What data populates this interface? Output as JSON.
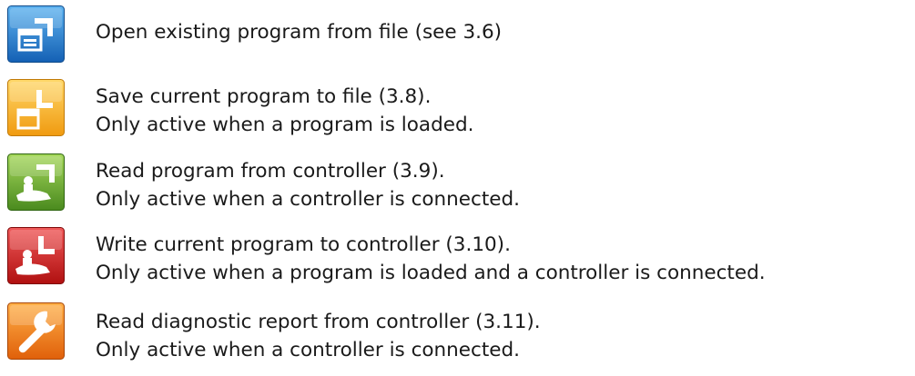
{
  "items": [
    {
      "icon": "open-folder-icon",
      "color": "#1e78c8",
      "line1": "Open existing program from file (see 3.6)",
      "line2": ""
    },
    {
      "icon": "save-disk-icon",
      "color": "#f2a81c",
      "line1": "Save current program to file (3.8).",
      "line2": "Only active when a program is loaded."
    },
    {
      "icon": "read-from-controller-icon",
      "color": "#5c9e2a",
      "line1": "Read program from controller (3.9).",
      "line2": "Only active when a controller is connected."
    },
    {
      "icon": "write-to-controller-icon",
      "color": "#c81e1e",
      "line1": "Write current program to controller (3.10).",
      "line2": "Only active when a program is loaded and a controller is connected."
    },
    {
      "icon": "wrench-icon",
      "color": "#f07a14",
      "line1": "Read diagnostic report from controller (3.11).",
      "line2": "Only active when a controller is connected."
    }
  ]
}
